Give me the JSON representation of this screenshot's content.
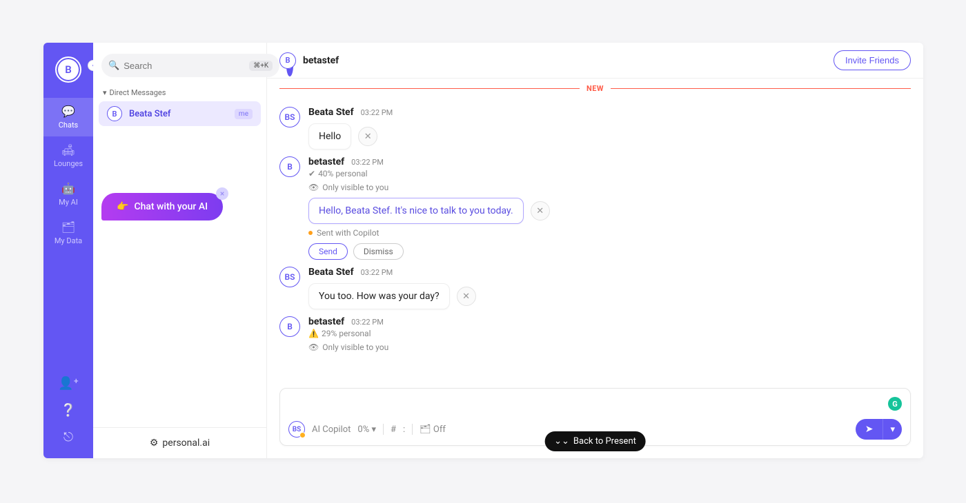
{
  "nav": {
    "avatar_initial": "B",
    "items": [
      {
        "icon": "💬",
        "label": "Chats"
      },
      {
        "icon": "🛋",
        "label": "Lounges"
      },
      {
        "icon": "🤖",
        "label": "My AI"
      },
      {
        "icon": "🗂",
        "label": "My Data"
      }
    ],
    "bottom": {
      "add_user": "+",
      "help": "?",
      "logout": "↪"
    }
  },
  "sidebar": {
    "search_placeholder": "Search",
    "shortcut": "⌘+K",
    "plus": "+",
    "section_label": "Direct Messages",
    "dm": {
      "initial": "B",
      "name": "Beata Stef",
      "badge": "me"
    },
    "ai_pill": "Chat with your AI",
    "ai_pill_emoji": "👉",
    "footer_brand": "personal.ai"
  },
  "header": {
    "avatar_initial": "B",
    "title": "betastef",
    "invite_label": "Invite Friends"
  },
  "divider_label": "NEW",
  "messages": [
    {
      "avatar": "BS",
      "author": "Beata Stef",
      "time": "03:22 PM",
      "bubble": "Hello",
      "kind": "user"
    },
    {
      "avatar": "B",
      "author": "betastef",
      "time": "03:22 PM",
      "meta": "40% personal",
      "visible_only": "Only visible to you",
      "bubble": "Hello, Beata Stef. It's nice to talk to you today.",
      "sent_with": "Sent with Copilot",
      "actions": {
        "send": "Send",
        "dismiss": "Dismiss"
      },
      "kind": "ai"
    },
    {
      "avatar": "BS",
      "author": "Beata Stef",
      "time": "03:22 PM",
      "bubble": "You too. How was your day?",
      "kind": "user"
    },
    {
      "avatar": "B",
      "author": "betastef",
      "time": "03:22 PM",
      "meta_warn": "29% personal",
      "visible_only": "Only visible to you",
      "kind": "ai_partial"
    }
  ],
  "composer": {
    "avatar": "BS",
    "copilot_label": "AI Copilot",
    "copilot_pct": "0%",
    "hash": "#",
    "colon": ":",
    "stack_off": "Off",
    "grammarly": "G"
  },
  "back_present": "Back to Present"
}
